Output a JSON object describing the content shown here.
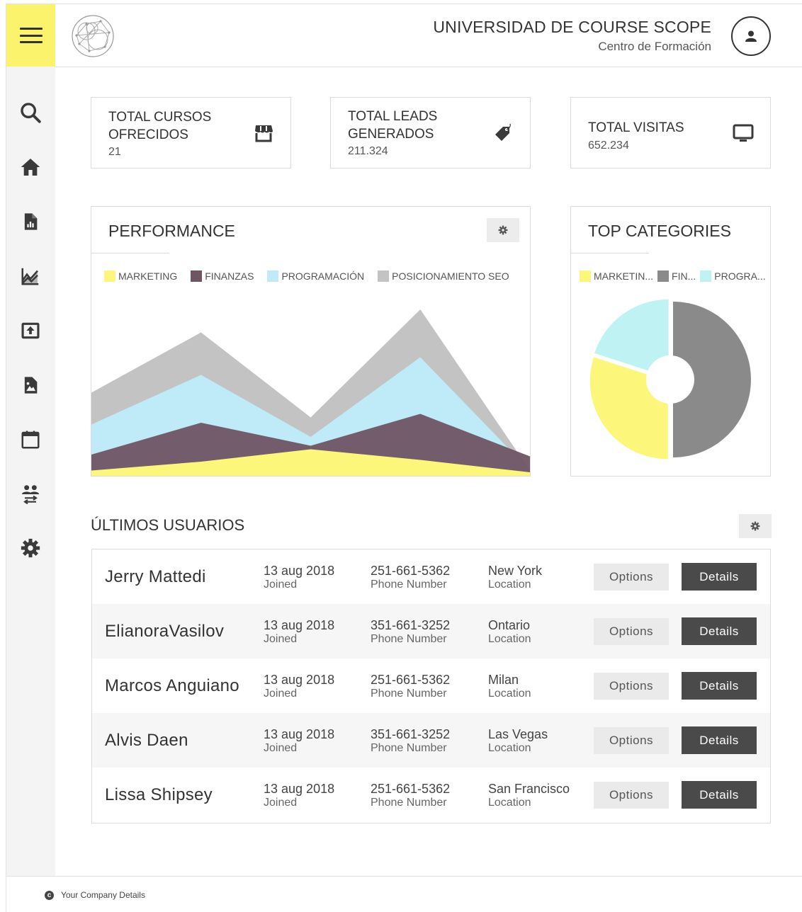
{
  "header": {
    "org_name": "UNIVERSIDAD DE COURSE SCOPE",
    "org_subtitle": "Centro de Formación"
  },
  "sidebar": {
    "accent": "#fbf36b",
    "items": [
      {
        "icon": "search-icon"
      },
      {
        "icon": "home-icon"
      },
      {
        "icon": "report-icon"
      },
      {
        "icon": "analytics-icon"
      },
      {
        "icon": "upload-icon"
      },
      {
        "icon": "image-file-icon"
      },
      {
        "icon": "calendar-icon"
      },
      {
        "icon": "users-swap-icon"
      },
      {
        "icon": "settings-icon"
      }
    ]
  },
  "stats": [
    {
      "title_line1": "TOTAL CURSOS",
      "title_line2": "OFRECIDOS",
      "value": "21",
      "icon": "store-icon"
    },
    {
      "title_line1": "TOTAL LEADS",
      "title_line2": "GENERADOS",
      "value": "211.324",
      "icon": "tag-icon"
    },
    {
      "title_line1": "TOTAL VISITAS",
      "value": "652.234",
      "icon": "monitor-icon"
    }
  ],
  "performance": {
    "title": "PERFORMANCE",
    "legend": [
      "MARKETING",
      "FINANZAS",
      "PROGRAMACIÓN",
      "POSICIONAMIENTO SEO"
    ]
  },
  "top_categories": {
    "title": "TOP CATEGORIES",
    "legend": [
      "MARKETIN...",
      "FIN...",
      "PROGRA..."
    ]
  },
  "chart_data": [
    {
      "type": "area",
      "x": [
        0,
        1,
        2,
        3,
        4
      ],
      "ylim": [
        0,
        100
      ],
      "grid": false,
      "legend_position": "top",
      "series": [
        {
          "name": "POSICIONAMIENTO SEO",
          "color": "#c3c3c3",
          "values": [
            47,
            81,
            33,
            94,
            3
          ]
        },
        {
          "name": "PROGRAMACIÓN",
          "color": "#bfeaf8",
          "values": [
            29,
            57,
            22,
            67,
            3
          ]
        },
        {
          "name": "FINANZAS",
          "color": "#6f5564",
          "values": [
            12,
            30,
            17,
            35,
            11
          ]
        },
        {
          "name": "MARKETING",
          "color": "#fcf77a",
          "values": [
            3,
            8,
            15,
            9,
            2
          ]
        }
      ]
    },
    {
      "type": "pie",
      "donut": true,
      "legend_position": "top",
      "slices": [
        {
          "name": "MARKETIN...",
          "value": 30,
          "color": "#fcf77a"
        },
        {
          "name": "FIN...",
          "value": 50,
          "color": "#8a8a8a"
        },
        {
          "name": "PROGRA...",
          "value": 20,
          "color": "#bff3f3"
        }
      ]
    }
  ],
  "users": {
    "title": "ÚLTIMOS USUARIOS",
    "rows": [
      {
        "name": "Jerry Mattedi",
        "date": "13 aug 2018",
        "date_label": "Joined",
        "phone": "251-661-5362",
        "phone_label": "Phone Number",
        "location": "New York",
        "location_label": "Location",
        "options": "Options",
        "details": "Details"
      },
      {
        "name": "ElianoraVasilov",
        "date": "13 aug 2018",
        "date_label": "Joined",
        "phone": "351-661-3252",
        "phone_label": "Phone Number",
        "location": "Ontario",
        "location_label": "Location",
        "options": "Options",
        "details": "Details"
      },
      {
        "name": "Marcos Anguiano",
        "date": "13 aug 2018",
        "date_label": "Joined",
        "phone": "251-661-5362",
        "phone_label": "Phone Number",
        "location": "Milan",
        "location_label": "Location",
        "options": "Options",
        "details": "Details"
      },
      {
        "name": "Alvis Daen",
        "date": "13 aug 2018",
        "date_label": "Joined",
        "phone": "351-661-3252",
        "phone_label": "Phone Number",
        "location": "Las Vegas",
        "location_label": "Location",
        "options": "Options",
        "details": "Details"
      },
      {
        "name": "Lissa Shipsey",
        "date": "13 aug 2018",
        "date_label": "Joined",
        "phone": "251-661-5362",
        "phone_label": "Phone Number",
        "location": "San Francisco",
        "location_label": "Location",
        "options": "Options",
        "details": "Details"
      }
    ]
  },
  "footer": {
    "text": "Your Company Details"
  }
}
